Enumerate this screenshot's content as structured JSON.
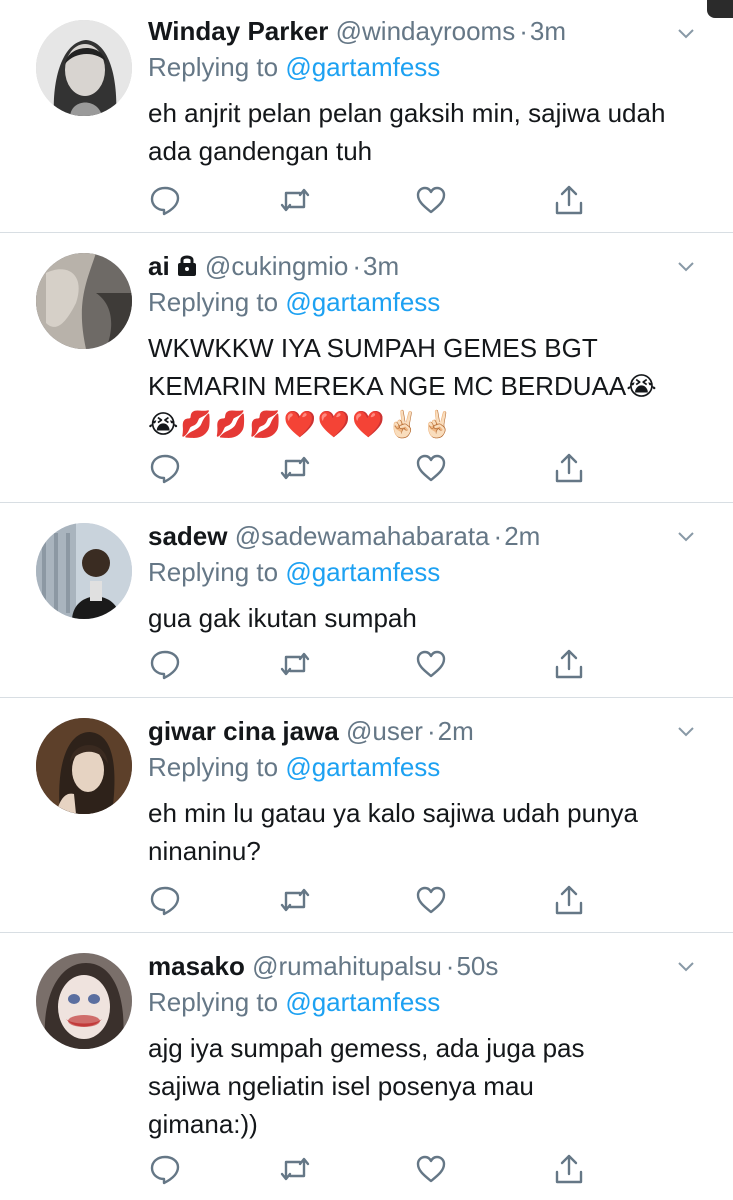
{
  "replying_prefix": "Replying to",
  "replies": [
    {
      "name": "Winday Parker",
      "handle": "@windayrooms",
      "time": "3m",
      "reply_to": "@gartamfess",
      "text": "eh anjrit pelan pelan gaksih min, sajiwa udah ada gandengan tuh",
      "emoji": "",
      "protected": false,
      "avatar_color": "#cfcfcf"
    },
    {
      "name": "ai",
      "handle": "@cukingmio",
      "time": "3m",
      "reply_to": "@gartamfess",
      "text": "WKWKKW IYA SUMPAH GEMES BGT KEMARIN MEREKA NGE MC BERDUAA😭",
      "emoji": "😭💋💋💋❤️❤️❤️✌🏻✌🏻",
      "protected": true,
      "avatar_color": "#8a8580"
    },
    {
      "name": "sadew",
      "handle": "@sadewamahabarata",
      "time": "2m",
      "reply_to": "@gartamfess",
      "text": "gua gak ikutan sumpah",
      "emoji": "",
      "protected": false,
      "avatar_color": "#b9c4cf"
    },
    {
      "name": "giwar cina jawa",
      "handle": "@user",
      "time": "2m",
      "reply_to": "@gartamfess",
      "text": "eh min lu gatau ya kalo sajiwa udah punya ninaninu?",
      "emoji": "",
      "protected": false,
      "avatar_color": "#5a4030"
    },
    {
      "name": "masako",
      "handle": "@rumahitupalsu",
      "time": "50s",
      "reply_to": "@gartamfess",
      "text": "ajg iya sumpah gemess, ada juga pas sajiwa ngeliatin isel posenya mau gimana:))",
      "emoji": "",
      "protected": false,
      "avatar_color": "#d9c7c0"
    }
  ],
  "icons": {
    "reply": "reply-icon",
    "retweet": "retweet-icon",
    "like": "heart-icon",
    "share": "share-icon",
    "more": "chevron-down-icon",
    "lock": "lock-icon"
  },
  "colors": {
    "text": "#14171a",
    "secondary": "#657786",
    "link": "#1da1f2",
    "divider": "#d8dee3"
  }
}
